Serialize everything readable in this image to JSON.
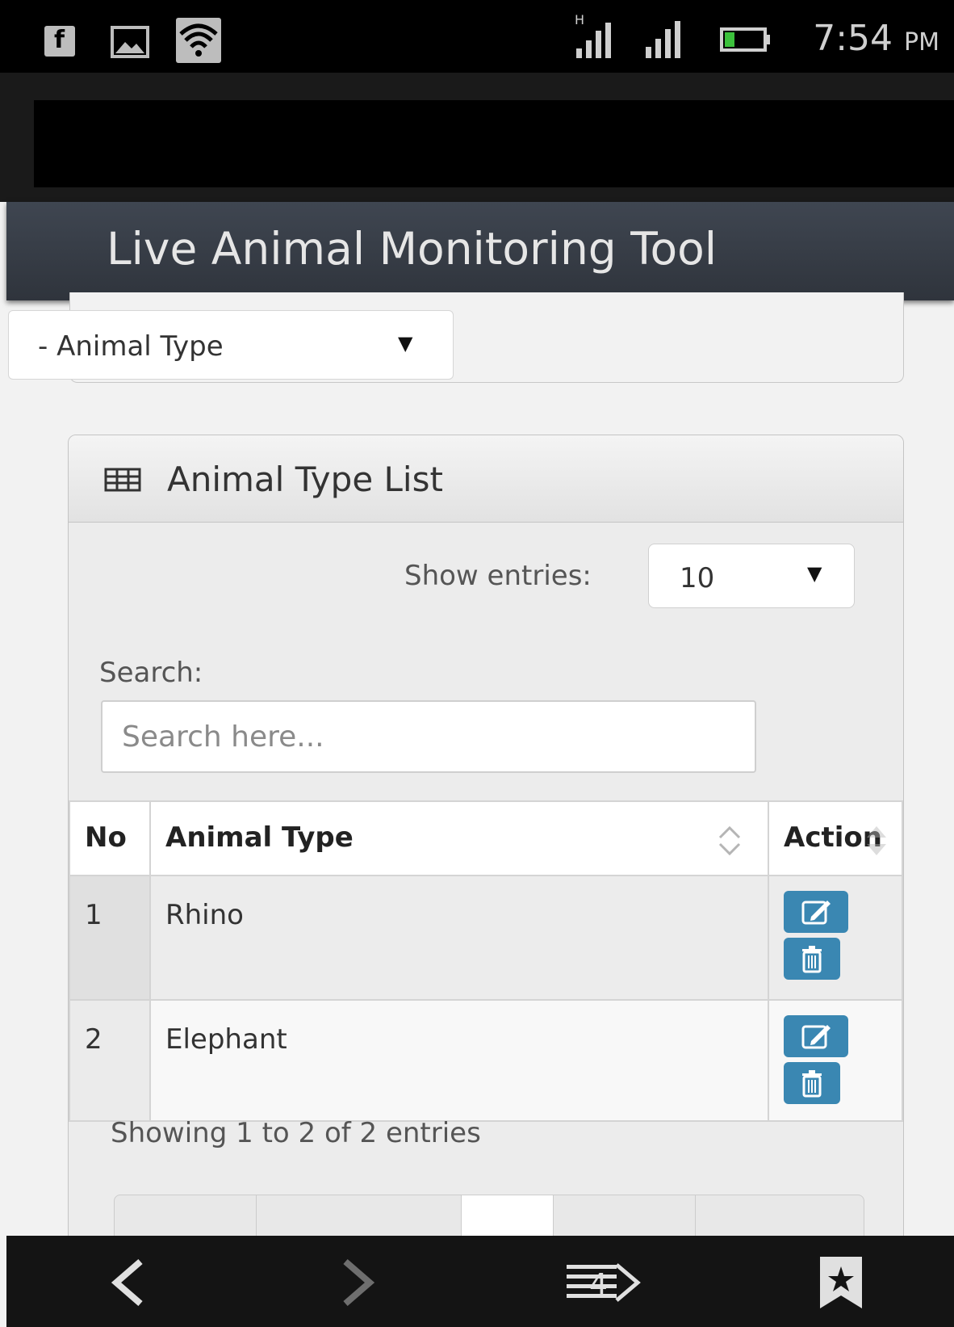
{
  "status_bar": {
    "time": "7:54",
    "ampm": "PM",
    "network_label": "H"
  },
  "header": {
    "title": "Live Animal Monitoring Tool"
  },
  "filter": {
    "animal_type_select": "- Animal Type"
  },
  "panel": {
    "title": "Animal Type List",
    "show_entries_label": "Show entries:",
    "show_entries_value": "10",
    "search_label": "Search:",
    "search_placeholder": "Search here..."
  },
  "table": {
    "headers": [
      "No",
      "Animal Type",
      "Action"
    ],
    "rows": [
      {
        "no": "1",
        "animal_type": "Rhino"
      },
      {
        "no": "2",
        "animal_type": "Elephant"
      }
    ]
  },
  "info_text": "Showing 1 to 2 of 2 entries",
  "colors": {
    "header_bg": "#363c45",
    "action_button": "#3a87b2"
  },
  "icons": [
    "facebook-icon",
    "picture-icon",
    "wifi-icon",
    "signal-icon",
    "battery-icon",
    "table-icon",
    "sort-icon",
    "edit-icon",
    "trash-icon",
    "back-icon",
    "forward-icon",
    "tabs-icon",
    "bookmark-icon"
  ],
  "bottom_nav": {
    "tabs_count": "4"
  }
}
